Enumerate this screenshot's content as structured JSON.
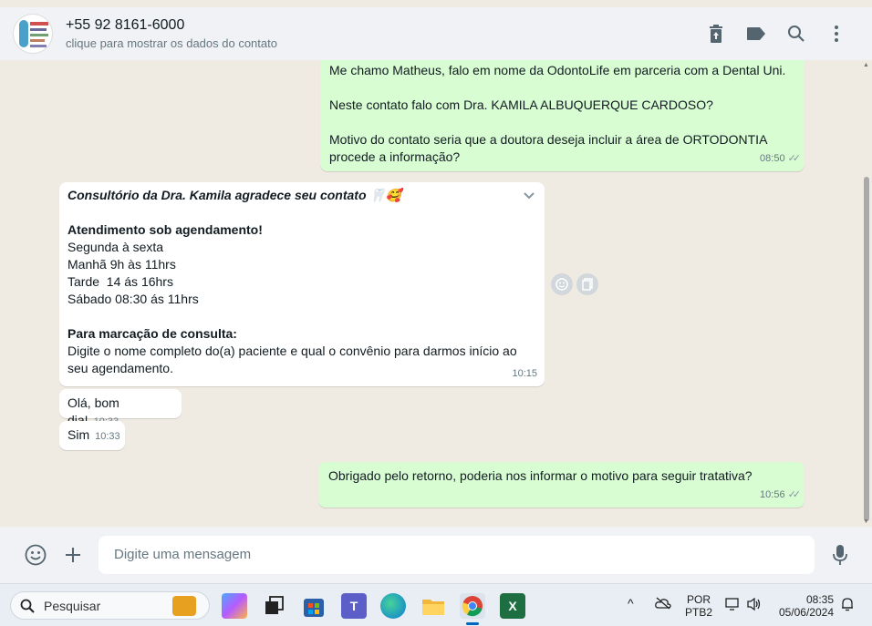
{
  "header": {
    "contact_name": "+55 92 8161-6000",
    "contact_sub": "clique para mostrar os dados do contato",
    "icons": [
      "trash-icon",
      "label-icon",
      "search-icon",
      "menu-icon"
    ]
  },
  "messages": [
    {
      "direction": "out",
      "lines": [
        "Me chamo Matheus, falo em nome da OdontoLife em parceria com a Dental Uni.",
        "Neste contato falo com Dra. KAMILA ALBUQUERQUE CARDOSO?",
        "Motivo do contato seria que a doutora deseja incluir a área de ORTODONTIA procede a informação?"
      ],
      "time": "08:50"
    },
    {
      "direction": "in",
      "title": "Consultório da Dra. Kamila agradece seu contato 🦷🥰",
      "schedule_heading": "Atendimento sob agendamento!",
      "schedule_lines": [
        "Segunda à sexta",
        "Manhã 9h às 11hrs",
        "Tarde  14 ás 16hrs",
        "Sábado 08:30 ás 11hrs"
      ],
      "booking_heading": "Para marcação de consulta:",
      "booking_text": "Digite o nome completo do(a) paciente e qual o convênio para darmos início ao seu agendamento.",
      "time": "10:15"
    },
    {
      "direction": "in",
      "text": "Olá, bom dia!",
      "time": "10:33"
    },
    {
      "direction": "in",
      "text": "Sim",
      "time": "10:33"
    },
    {
      "direction": "out",
      "text": "Obrigado pelo retorno, poderia nos informar o motivo para seguir tratativa?",
      "time": "10:56"
    }
  ],
  "composer": {
    "placeholder": "Digite uma mensagem"
  },
  "taskbar": {
    "search_label": "Pesquisar",
    "lang_top": "POR",
    "lang_bottom": "PTB2",
    "clock_time": "08:35",
    "clock_date": "05/06/2024"
  },
  "colors": {
    "outgoing_bubble": "#d9fdd3",
    "incoming_bubble": "#ffffff",
    "chat_background": "#efeae2",
    "header_background": "#f0f2f5"
  }
}
